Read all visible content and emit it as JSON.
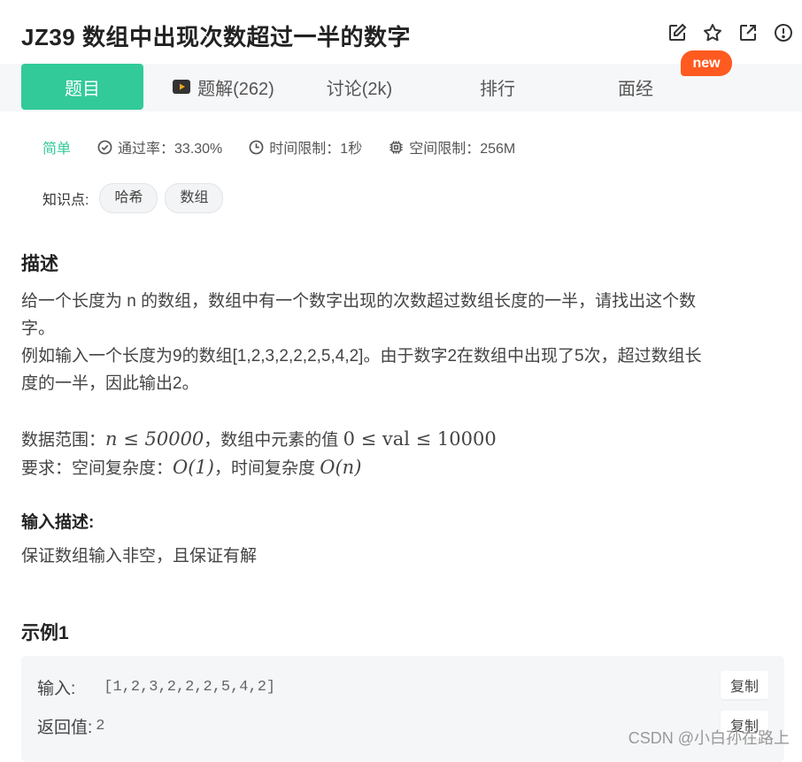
{
  "header": {
    "title": "JZ39  数组中出现次数超过一半的数字",
    "icons": [
      "edit-icon",
      "star-icon",
      "external-link-icon",
      "alert-icon"
    ]
  },
  "tabs": [
    {
      "label": "题目",
      "active": true
    },
    {
      "label": "题解(262)",
      "icon": "video-icon"
    },
    {
      "label": "讨论(2k)"
    },
    {
      "label": "排行"
    },
    {
      "label": "面经"
    }
  ],
  "badge": {
    "text": "new",
    "color": "#ff5a1f"
  },
  "meta": {
    "difficulty": "简单",
    "pass_rate": "通过率：33.30%",
    "time_limit": "时间限制：1秒",
    "space_limit": "空间限制：256M"
  },
  "knowledge": {
    "label": "知识点:",
    "tags": [
      "哈希",
      "数组"
    ]
  },
  "description": {
    "heading": "描述",
    "line1": "给一个长度为 n 的数组，数组中有一个数字出现的次数超过数组长度的一半，请找出这个数",
    "line2": "字。",
    "line3": "例如输入一个长度为9的数组[1,2,3,2,2,2,5,4,2]。由于数字2在数组中出现了5次，超过数组长",
    "line4": "度的一半，因此输出2。",
    "range_prefix": "数据范围：",
    "range_n": "n ≤ 50000",
    "range_mid": "，数组中元素的值 ",
    "range_val": "0 ≤ val ≤ 10000",
    "req_prefix": "要求：空间复杂度：",
    "req_space": "O(1)",
    "req_mid": "，时间复杂度 ",
    "req_time": "O(n)"
  },
  "input_desc": {
    "heading": "输入描述:",
    "text": "保证数组输入非空，且保证有解"
  },
  "example": {
    "heading": "示例1",
    "input_label": "输入:",
    "input_value": "[1,2,3,2,2,2,5,4,2]",
    "output_label": "返回值:",
    "output_value": "2",
    "copy_label": "复制"
  },
  "watermark": "CSDN @小白孙在路上",
  "colors": {
    "accent": "#32ca99",
    "badge": "#ff5a1f"
  }
}
